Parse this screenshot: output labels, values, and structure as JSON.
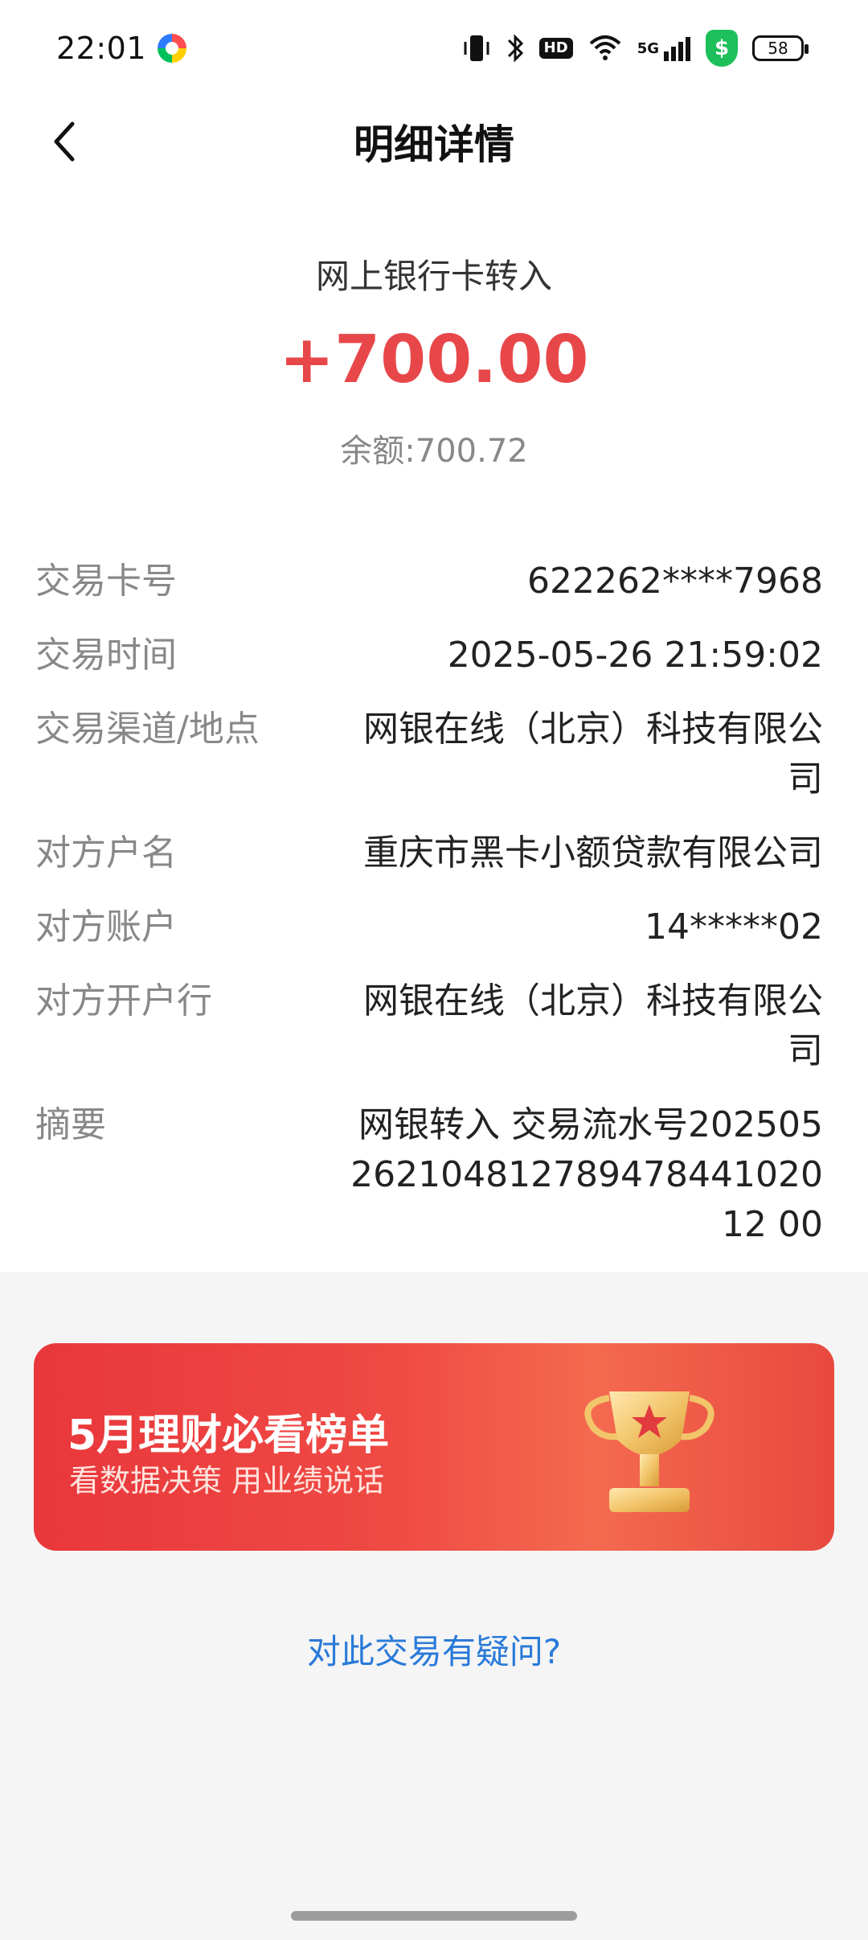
{
  "status_bar": {
    "time": "22:01",
    "network_label": "5G",
    "battery": "58",
    "hd_label": "HD"
  },
  "header": {
    "title": "明细详情",
    "back_icon": "chevron-left-icon"
  },
  "transaction": {
    "type": "网上银行卡转入",
    "amount": "+700.00",
    "balance": "余额:700.72",
    "amount_color": "#e8474a",
    "rows": [
      {
        "label": "交易卡号",
        "value": "622262****7968"
      },
      {
        "label": "交易时间",
        "value": "2025-05-26 21:59:02"
      },
      {
        "label": "交易渠道/地点",
        "value": "网银在线（北京）科技有限公司"
      },
      {
        "label": "对方户名",
        "value": "重庆市黑卡小额贷款有限公司"
      },
      {
        "label": "对方账户",
        "value": "14*****02"
      },
      {
        "label": "对方开户行",
        "value": "网银在线（北京）科技有限公司"
      },
      {
        "label": "摘要",
        "value": "网银转入 交易流水号20250526210481278947844102012 00"
      }
    ]
  },
  "banner": {
    "title": "5月理财必看榜单",
    "subtitle": "看数据决策 用业绩说话",
    "icon": "trophy-icon"
  },
  "footer": {
    "question_link": "对此交易有疑问?"
  }
}
